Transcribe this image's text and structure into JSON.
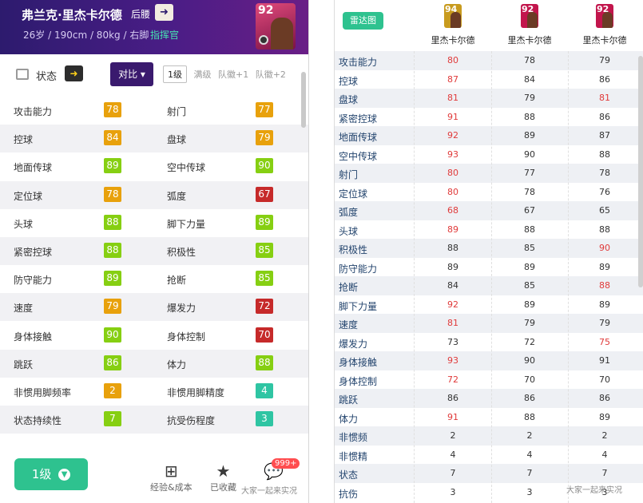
{
  "left": {
    "header": {
      "name": "弗兰克·里杰卡尔德",
      "position": "后腰",
      "arrow": "➜",
      "info": "26岁 / 190cm / 80kg / 右脚",
      "role": "指挥官",
      "card_overall": "92"
    },
    "status_label": "状态",
    "status_arrow": "➜",
    "compare_label": "对比 ▾",
    "levels": [
      "1级",
      "满级",
      "队徽+1",
      "队徽+2"
    ],
    "stats": [
      {
        "a": "攻击能力",
        "av": "78",
        "ac": "#e8a10c",
        "b": "射门",
        "bv": "77",
        "bc": "#e8a10c"
      },
      {
        "a": "控球",
        "av": "84",
        "ac": "#e8a10c",
        "b": "盘球",
        "bv": "79",
        "bc": "#e8a10c"
      },
      {
        "a": "地面传球",
        "av": "89",
        "ac": "#86cf12",
        "b": "空中传球",
        "bv": "90",
        "bc": "#86cf12"
      },
      {
        "a": "定位球",
        "av": "78",
        "ac": "#e8a10c",
        "b": "弧度",
        "bv": "67",
        "bc": "#c62a2a"
      },
      {
        "a": "头球",
        "av": "88",
        "ac": "#86cf12",
        "b": "脚下力量",
        "bv": "89",
        "bc": "#86cf12"
      },
      {
        "a": "紧密控球",
        "av": "88",
        "ac": "#86cf12",
        "b": "积极性",
        "bv": "85",
        "bc": "#86cf12"
      },
      {
        "a": "防守能力",
        "av": "89",
        "ac": "#86cf12",
        "b": "抢断",
        "bv": "85",
        "bc": "#86cf12"
      },
      {
        "a": "速度",
        "av": "79",
        "ac": "#e8a10c",
        "b": "爆发力",
        "bv": "72",
        "bc": "#c62a2a"
      },
      {
        "a": "身体接触",
        "av": "90",
        "ac": "#86cf12",
        "b": "身体控制",
        "bv": "70",
        "bc": "#c62a2a"
      },
      {
        "a": "跳跃",
        "av": "86",
        "ac": "#86cf12",
        "b": "体力",
        "bv": "88",
        "bc": "#86cf12"
      },
      {
        "a": "非惯用脚频率",
        "av": "2",
        "ac": "#e8a10c",
        "b": "非惯用脚精度",
        "bv": "4",
        "bc": "#2fc5a3"
      },
      {
        "a": "状态持续性",
        "av": "7",
        "ac": "#86cf12",
        "b": "抗受伤程度",
        "bv": "3",
        "bc": "#2fc5a3"
      }
    ],
    "footer": {
      "level_button": "1级",
      "exp_label": "经验&成本",
      "collect_label": "已收藏",
      "notification": "999+",
      "watermark": "大家一起来实况"
    }
  },
  "right": {
    "radar_button": "雷达图",
    "players": [
      {
        "overall": "94",
        "name": "里杰卡尔德",
        "card_color": "#c89b1e"
      },
      {
        "overall": "92",
        "name": "里杰卡尔德",
        "card_color": "#c2154c"
      },
      {
        "overall": "92",
        "name": "里杰卡尔德",
        "card_color": "#c2154c"
      }
    ],
    "rows": [
      {
        "name": "攻击能力",
        "v": [
          "80",
          "78",
          "79"
        ],
        "hl": [
          true,
          false,
          false
        ]
      },
      {
        "name": "控球",
        "v": [
          "87",
          "84",
          "86"
        ],
        "hl": [
          true,
          false,
          false
        ]
      },
      {
        "name": "盘球",
        "v": [
          "81",
          "79",
          "81"
        ],
        "hl": [
          true,
          false,
          true
        ]
      },
      {
        "name": "紧密控球",
        "v": [
          "91",
          "88",
          "86"
        ],
        "hl": [
          true,
          false,
          false
        ]
      },
      {
        "name": "地面传球",
        "v": [
          "92",
          "89",
          "87"
        ],
        "hl": [
          true,
          false,
          false
        ]
      },
      {
        "name": "空中传球",
        "v": [
          "93",
          "90",
          "88"
        ],
        "hl": [
          true,
          false,
          false
        ]
      },
      {
        "name": "射门",
        "v": [
          "80",
          "77",
          "78"
        ],
        "hl": [
          true,
          false,
          false
        ]
      },
      {
        "name": "定位球",
        "v": [
          "80",
          "78",
          "76"
        ],
        "hl": [
          true,
          false,
          false
        ]
      },
      {
        "name": "弧度",
        "v": [
          "68",
          "67",
          "65"
        ],
        "hl": [
          true,
          false,
          false
        ]
      },
      {
        "name": "头球",
        "v": [
          "89",
          "88",
          "88"
        ],
        "hl": [
          true,
          false,
          false
        ]
      },
      {
        "name": "积极性",
        "v": [
          "88",
          "85",
          "90"
        ],
        "hl": [
          false,
          false,
          true
        ]
      },
      {
        "name": "防守能力",
        "v": [
          "89",
          "89",
          "89"
        ],
        "hl": [
          false,
          false,
          false
        ]
      },
      {
        "name": "抢断",
        "v": [
          "84",
          "85",
          "88"
        ],
        "hl": [
          false,
          false,
          true
        ]
      },
      {
        "name": "脚下力量",
        "v": [
          "92",
          "89",
          "89"
        ],
        "hl": [
          true,
          false,
          false
        ]
      },
      {
        "name": "速度",
        "v": [
          "81",
          "79",
          "79"
        ],
        "hl": [
          true,
          false,
          false
        ]
      },
      {
        "name": "爆发力",
        "v": [
          "73",
          "72",
          "75"
        ],
        "hl": [
          false,
          false,
          true
        ]
      },
      {
        "name": "身体接触",
        "v": [
          "93",
          "90",
          "91"
        ],
        "hl": [
          true,
          false,
          false
        ]
      },
      {
        "name": "身体控制",
        "v": [
          "72",
          "70",
          "70"
        ],
        "hl": [
          true,
          false,
          false
        ]
      },
      {
        "name": "跳跃",
        "v": [
          "86",
          "86",
          "86"
        ],
        "hl": [
          false,
          false,
          false
        ]
      },
      {
        "name": "体力",
        "v": [
          "91",
          "88",
          "89"
        ],
        "hl": [
          true,
          false,
          false
        ]
      },
      {
        "name": "非惯频",
        "v": [
          "2",
          "2",
          "2"
        ],
        "hl": [
          false,
          false,
          false
        ]
      },
      {
        "name": "非惯精",
        "v": [
          "4",
          "4",
          "4"
        ],
        "hl": [
          false,
          false,
          false
        ]
      },
      {
        "name": "状态",
        "v": [
          "7",
          "7",
          "7"
        ],
        "hl": [
          false,
          false,
          false
        ]
      },
      {
        "name": "抗伤",
        "v": [
          "3",
          "3",
          "3"
        ],
        "hl": [
          false,
          false,
          false
        ]
      }
    ],
    "watermark": "大家一起来实况"
  }
}
